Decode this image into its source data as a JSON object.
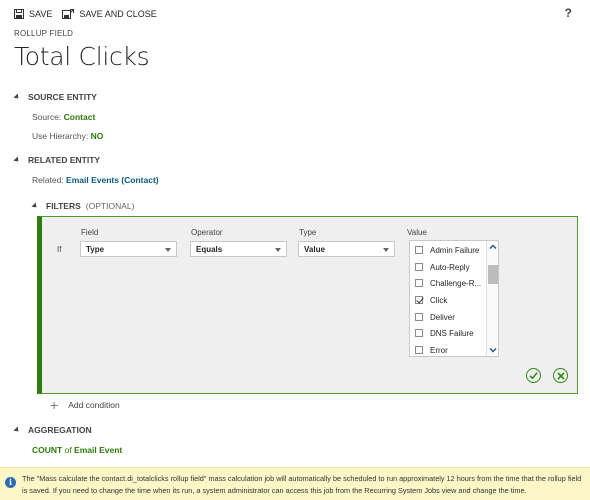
{
  "toolbar": {
    "save_label": "SAVE",
    "save_close_label": "SAVE AND CLOSE",
    "help_label": "?"
  },
  "header": {
    "entity_label": "ROLLUP FIELD",
    "title": "Total Clicks"
  },
  "source_entity": {
    "heading": "SOURCE ENTITY",
    "source_label": "Source: ",
    "source_value": "Contact",
    "hierarchy_label": "Use Hierarchy: ",
    "hierarchy_value": "NO"
  },
  "related_entity": {
    "heading": "RELATED ENTITY",
    "related_label": "Related: ",
    "related_value": "Email Events (Contact)"
  },
  "filters": {
    "heading": "FILTERS",
    "optional": "(OPTIONAL)",
    "columns": {
      "field": "Field",
      "operator": "Operator",
      "type": "Type",
      "value": "Value"
    },
    "if_label": "If",
    "field_value": "Type",
    "operator_value": "Equals",
    "type_value": "Value",
    "options": [
      {
        "label": "Admin Failure",
        "checked": false
      },
      {
        "label": "Auto-Reply",
        "checked": false
      },
      {
        "label": "Challenge-R...",
        "checked": false
      },
      {
        "label": "Click",
        "checked": true
      },
      {
        "label": "Deliver",
        "checked": false
      },
      {
        "label": "DNS Failure",
        "checked": false
      },
      {
        "label": "Error",
        "checked": false
      }
    ]
  },
  "add_condition": "Add condition",
  "aggregation": {
    "heading": "AGGREGATION",
    "func": "COUNT",
    "of": " of ",
    "entity": "Email Event"
  },
  "notice": {
    "text": "The \"Mass calculate the contact.di_totalclicks rollup field\" mass calculation job will automatically be scheduled to run approximately 12 hours from the time that the rollup field is saved. If you need to change the time when its run, a system administrator can access this job from the Recurring System Jobs view and change the time."
  },
  "colors": {
    "accent_green": "#2f7d0e",
    "link_blue": "#0a5a7a",
    "notice_bg": "#fdf6c7"
  }
}
